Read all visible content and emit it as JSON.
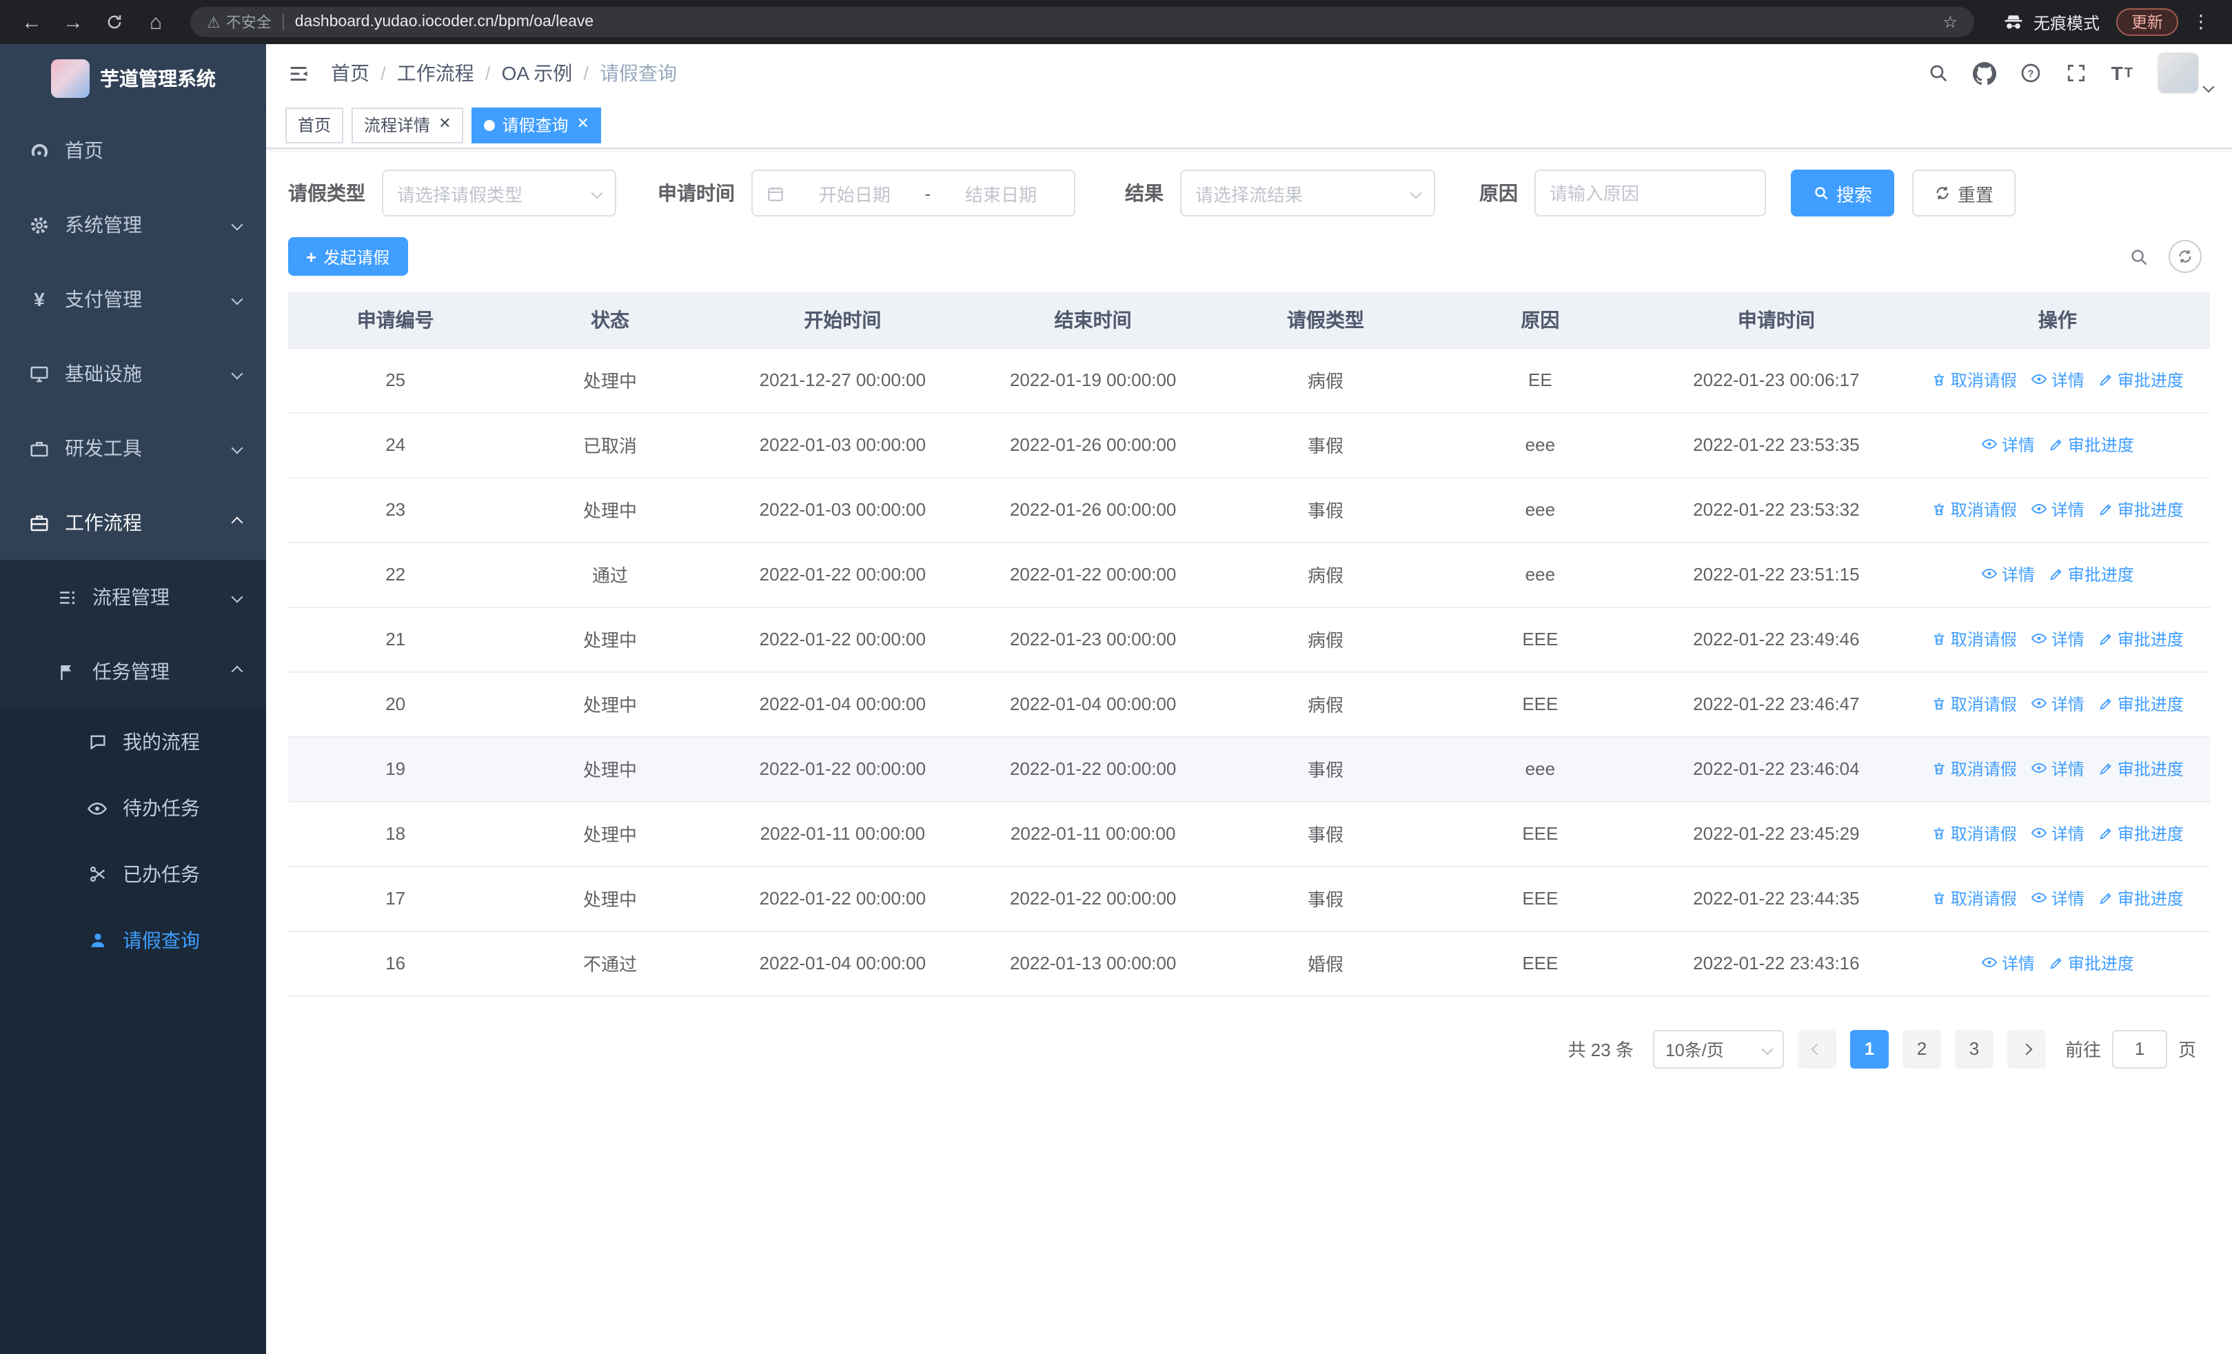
{
  "browser": {
    "security_warning": "不安全",
    "url": "dashboard.yudao.iocoder.cn/bpm/oa/leave",
    "incognito_label": "无痕模式",
    "update_label": "更新"
  },
  "sidebar": {
    "logo_title": "芋道管理系统",
    "items": [
      {
        "label": "首页"
      },
      {
        "label": "系统管理"
      },
      {
        "label": "支付管理"
      },
      {
        "label": "基础设施"
      },
      {
        "label": "研发工具"
      },
      {
        "label": "工作流程"
      }
    ],
    "submenu": {
      "process_mgmt": "流程管理",
      "task_mgmt": "任务管理",
      "children": [
        {
          "label": "我的流程"
        },
        {
          "label": "待办任务"
        },
        {
          "label": "已办任务"
        },
        {
          "label": "请假查询"
        }
      ]
    }
  },
  "breadcrumb": [
    "首页",
    "工作流程",
    "OA 示例",
    "请假查询"
  ],
  "breadcrumb_separator": "/",
  "tabs": [
    {
      "label": "首页"
    },
    {
      "label": "流程详情"
    },
    {
      "label": "请假查询"
    }
  ],
  "filters": {
    "leave_type_label": "请假类型",
    "leave_type_placeholder": "请选择请假类型",
    "apply_time_label": "申请时间",
    "start_date_placeholder": "开始日期",
    "date_separator": "-",
    "end_date_placeholder": "结束日期",
    "result_label": "结果",
    "result_placeholder": "请选择流结果",
    "reason_label": "原因",
    "reason_placeholder": "请输入原因",
    "search_button": "搜索",
    "reset_button": "重置"
  },
  "toolbar": {
    "create_button": "发起请假"
  },
  "table": {
    "columns": [
      "申请编号",
      "状态",
      "开始时间",
      "结束时间",
      "请假类型",
      "原因",
      "申请时间",
      "操作"
    ],
    "actions": {
      "cancel": "取消请假",
      "detail": "详情",
      "progress": "审批进度"
    },
    "rows": [
      {
        "id": "25",
        "status": "处理中",
        "start": "2021-12-27 00:00:00",
        "end": "2022-01-19 00:00:00",
        "type": "病假",
        "reason": "EE",
        "apply_time": "2022-01-23 00:06:17",
        "actions": [
          "cancel",
          "detail",
          "progress"
        ],
        "hover": false
      },
      {
        "id": "24",
        "status": "已取消",
        "start": "2022-01-03 00:00:00",
        "end": "2022-01-26 00:00:00",
        "type": "事假",
        "reason": "eee",
        "apply_time": "2022-01-22 23:53:35",
        "actions": [
          "detail",
          "progress"
        ],
        "hover": false
      },
      {
        "id": "23",
        "status": "处理中",
        "start": "2022-01-03 00:00:00",
        "end": "2022-01-26 00:00:00",
        "type": "事假",
        "reason": "eee",
        "apply_time": "2022-01-22 23:53:32",
        "actions": [
          "cancel",
          "detail",
          "progress"
        ],
        "hover": false
      },
      {
        "id": "22",
        "status": "通过",
        "start": "2022-01-22 00:00:00",
        "end": "2022-01-22 00:00:00",
        "type": "病假",
        "reason": "eee",
        "apply_time": "2022-01-22 23:51:15",
        "actions": [
          "detail",
          "progress"
        ],
        "hover": false
      },
      {
        "id": "21",
        "status": "处理中",
        "start": "2022-01-22 00:00:00",
        "end": "2022-01-23 00:00:00",
        "type": "病假",
        "reason": "EEE",
        "apply_time": "2022-01-22 23:49:46",
        "actions": [
          "cancel",
          "detail",
          "progress"
        ],
        "hover": false
      },
      {
        "id": "20",
        "status": "处理中",
        "start": "2022-01-04 00:00:00",
        "end": "2022-01-04 00:00:00",
        "type": "病假",
        "reason": "EEE",
        "apply_time": "2022-01-22 23:46:47",
        "actions": [
          "cancel",
          "detail",
          "progress"
        ],
        "hover": false
      },
      {
        "id": "19",
        "status": "处理中",
        "start": "2022-01-22 00:00:00",
        "end": "2022-01-22 00:00:00",
        "type": "事假",
        "reason": "eee",
        "apply_time": "2022-01-22 23:46:04",
        "actions": [
          "cancel",
          "detail",
          "progress"
        ],
        "hover": true
      },
      {
        "id": "18",
        "status": "处理中",
        "start": "2022-01-11 00:00:00",
        "end": "2022-01-11 00:00:00",
        "type": "事假",
        "reason": "EEE",
        "apply_time": "2022-01-22 23:45:29",
        "actions": [
          "cancel",
          "detail",
          "progress"
        ],
        "hover": false
      },
      {
        "id": "17",
        "status": "处理中",
        "start": "2022-01-22 00:00:00",
        "end": "2022-01-22 00:00:00",
        "type": "事假",
        "reason": "EEE",
        "apply_time": "2022-01-22 23:44:35",
        "actions": [
          "cancel",
          "detail",
          "progress"
        ],
        "hover": false
      },
      {
        "id": "16",
        "status": "不通过",
        "start": "2022-01-04 00:00:00",
        "end": "2022-01-13 00:00:00",
        "type": "婚假",
        "reason": "EEE",
        "apply_time": "2022-01-22 23:43:16",
        "actions": [
          "detail",
          "progress"
        ],
        "hover": false
      }
    ]
  },
  "pagination": {
    "total": "共 23 条",
    "page_size": "10条/页",
    "pages": [
      "1",
      "2",
      "3"
    ],
    "active_page": "1",
    "goto_prefix": "前往",
    "goto_value": "1",
    "goto_suffix": "页"
  }
}
